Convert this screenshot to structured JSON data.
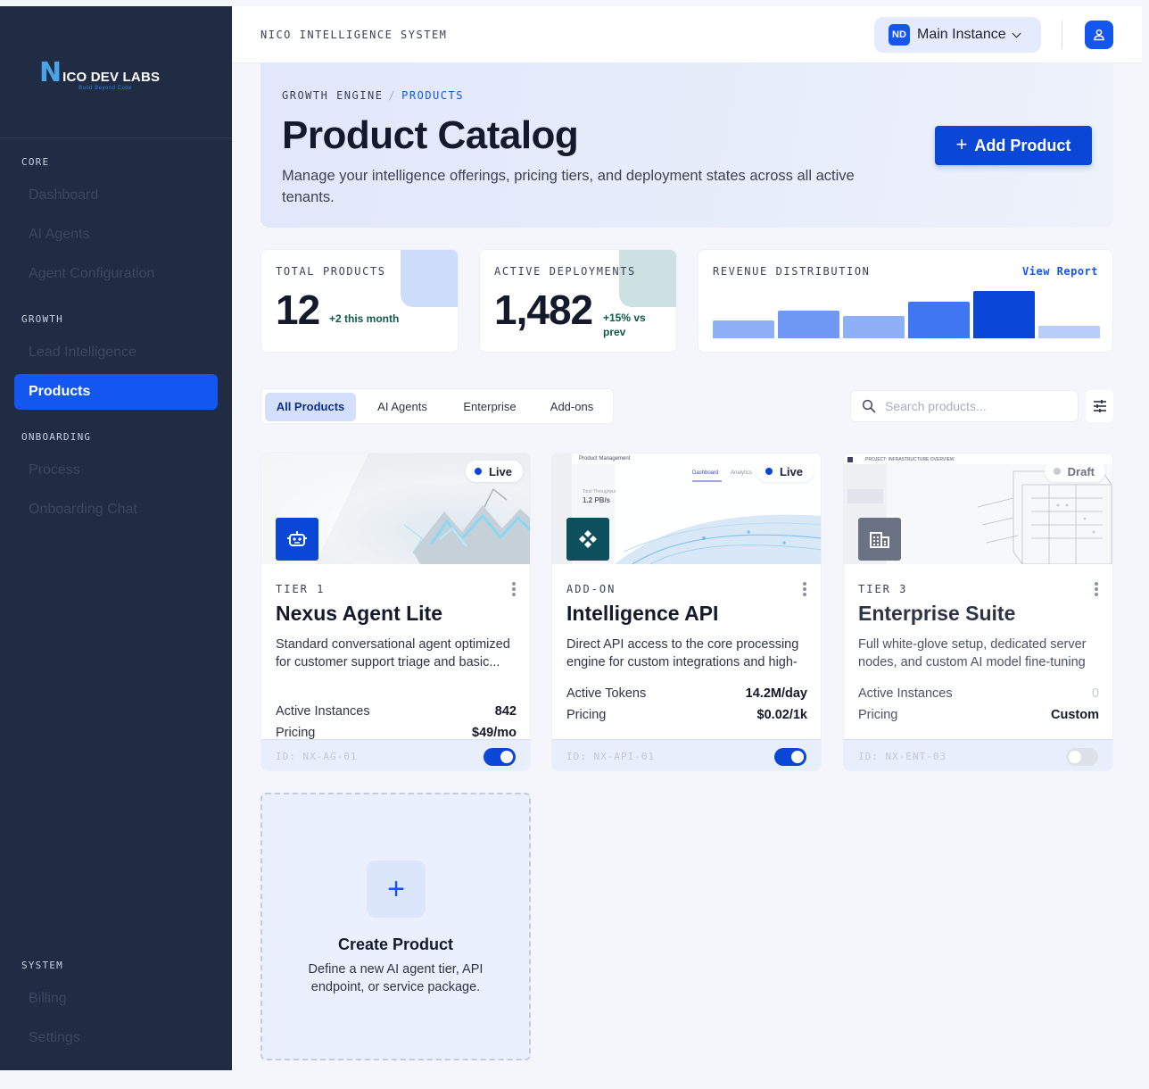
{
  "brand": {
    "logo_letter": "N",
    "name": "ICO DEV LABS",
    "tagline": "Build Beyond Code"
  },
  "sidebar": {
    "sections": [
      {
        "label": "CORE",
        "items": [
          {
            "label": "Dashboard"
          },
          {
            "label": "AI Agents"
          },
          {
            "label": "Agent Configuration"
          }
        ]
      },
      {
        "label": "GROWTH",
        "items": [
          {
            "label": "Lead Intelligence"
          },
          {
            "label": "Products",
            "active": true
          }
        ]
      },
      {
        "label": "ONBOARDING",
        "items": [
          {
            "label": "Process"
          },
          {
            "label": "Onboarding Chat"
          }
        ]
      },
      {
        "label": "SYSTEM",
        "items": [
          {
            "label": "Billing"
          },
          {
            "label": "Settings"
          }
        ]
      }
    ]
  },
  "topbar": {
    "system_title": "NICO INTELLIGENCE SYSTEM",
    "instance_badge": "ND",
    "instance_label": "Main Instance",
    "icons": {
      "instance_chevron": "chevron-down-icon",
      "user": "user-icon"
    }
  },
  "hero": {
    "breadcrumb": {
      "parent": "GROWTH ENGINE",
      "separator": "/",
      "current": "PRODUCTS"
    },
    "title": "Product Catalog",
    "subtitle": "Manage your intelligence offerings, pricing tiers, and deployment states across all active tenants.",
    "add_button": "Add Product"
  },
  "stats": {
    "total_products": {
      "label": "TOTAL PRODUCTS",
      "value": "12",
      "delta": "+2 this month"
    },
    "active_deployments": {
      "label": "ACTIVE DEPLOYMENTS",
      "value": "1,482",
      "delta": "+15% vs prev"
    },
    "revenue_distribution": {
      "label": "REVENUE DISTRIBUTION",
      "link": "View Report"
    }
  },
  "chart_data": {
    "type": "bar",
    "title": "REVENUE DISTRIBUTION",
    "categories": [
      "",
      "",
      "",
      "",
      "",
      ""
    ],
    "values": [
      18,
      28,
      23,
      37,
      48,
      13
    ],
    "colors": [
      "#8eb0f7",
      "#6f98f5",
      "#8eb0f7",
      "#3f77f2",
      "#0a47d6",
      "#b8cdf9"
    ],
    "ylim": [
      0,
      50
    ],
    "xlabel": "",
    "ylabel": "",
    "grid": false
  },
  "filters": {
    "tabs": [
      {
        "label": "All Products",
        "active": true
      },
      {
        "label": "AI Agents"
      },
      {
        "label": "Enterprise"
      },
      {
        "label": "Add-ons"
      }
    ],
    "search_placeholder": "Search products...",
    "icons": {
      "search": "search-icon",
      "filter": "sliders-icon"
    }
  },
  "products": [
    {
      "status": "Live",
      "tier": "TIER 1",
      "title": "Nexus Agent Lite",
      "description": "Standard conversational agent optimized\nfor customer support triage and basic...",
      "rows": [
        {
          "label": "Active Instances",
          "value": "842"
        },
        {
          "label": "Pricing",
          "value": "$49/mo"
        }
      ],
      "id": "ID: NX-AG-01",
      "enabled": true,
      "icon": "robot-icon",
      "icon_color": "#0a47d6"
    },
    {
      "status": "Live",
      "tier": "ADD-ON",
      "title": "Intelligence API",
      "description": "Direct API access to the core processing engine for custom integrations and high-",
      "rows": [
        {
          "label": "Active Tokens",
          "value": "14.2M/day"
        },
        {
          "label": "Pricing",
          "value": "$0.02/1k"
        }
      ],
      "id": "ID: NX-API-01",
      "enabled": true,
      "icon": "api-nodes-icon",
      "icon_color": "#0d4f5c",
      "preview": {
        "title": "Product Management",
        "tabs": [
          "Dashboard",
          "Analytics"
        ],
        "metric_label": "Total Throughput",
        "metric_value": "1.2 PB/s"
      }
    },
    {
      "status": "Draft",
      "tier": "TIER 3",
      "title": "Enterprise Suite",
      "description": "Full white-glove setup, dedicated server nodes, and custom AI model fine-tuning",
      "rows": [
        {
          "label": "Active Instances",
          "value": "0",
          "muted": true
        },
        {
          "label": "Pricing",
          "value": "Custom"
        }
      ],
      "id": "ID: NX-ENT-03",
      "enabled": false,
      "icon": "building-icon",
      "icon_color": "#6b7284",
      "preview": {
        "title": "PROJECT: INFRASTRUCTURE OVERVIEW"
      }
    }
  ],
  "create_card": {
    "title": "Create Product",
    "subtitle": "Define a new AI agent tier, API endpoint, or service package."
  }
}
